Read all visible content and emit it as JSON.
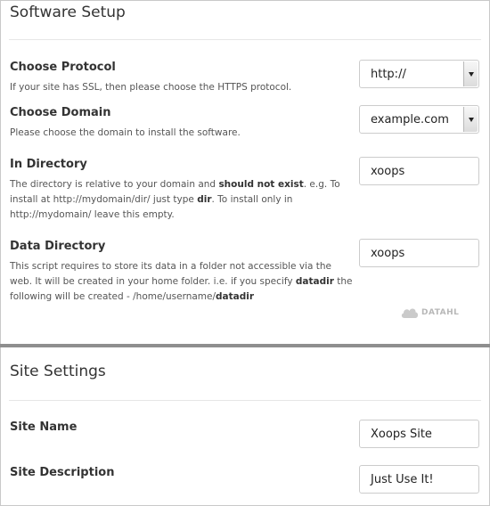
{
  "software_setup": {
    "title": "Software Setup",
    "protocol": {
      "label": "Choose Protocol",
      "description": "If your site has SSL, then please choose the HTTPS protocol.",
      "selected": "http://"
    },
    "domain": {
      "label": "Choose Domain",
      "description": "Please choose the domain to install the software.",
      "selected": "example.com"
    },
    "in_directory": {
      "label": "In Directory",
      "desc_1": "The directory is relative to your domain and ",
      "desc_2": "should not exist",
      "desc_3": ". e.g. To install at http://mydomain/dir/ just type ",
      "desc_4": "dir",
      "desc_5": ". To install only in http://mydomain/ leave this empty.",
      "value": "xoops"
    },
    "data_directory": {
      "label": "Data Directory",
      "desc_1": "This script requires to store its data in a folder not accessible via the web. It will be created in your home folder. i.e. if you specify ",
      "desc_2": "datadir",
      "desc_3": " the following will be created - /home/username/",
      "desc_4": "datadir",
      "value": "xoops"
    },
    "watermark_text": "DATAHL"
  },
  "site_settings": {
    "title": "Site Settings",
    "site_name": {
      "label": "Site Name",
      "value": "Xoops Site"
    },
    "site_description": {
      "label": "Site Description",
      "value": "Just Use It!"
    }
  },
  "colors": {
    "section_divider": "#8e8e8e",
    "text": "#333333",
    "border": "#cccccc"
  },
  "icons": {
    "select_arrow": "chevron-down-icon",
    "watermark": "cloud-logo-icon"
  }
}
